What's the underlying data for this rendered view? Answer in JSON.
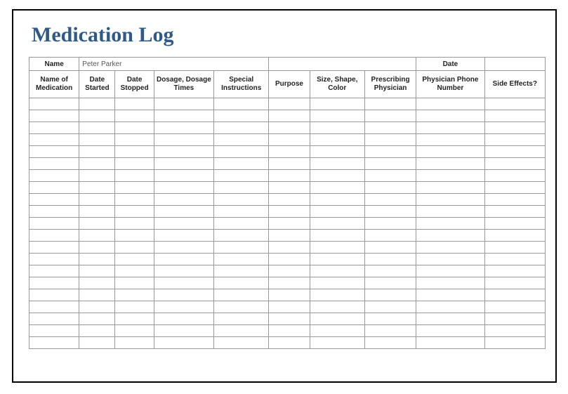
{
  "title": "Medication Log",
  "meta": {
    "name_label": "Name",
    "name_value": "Peter Parker",
    "date_label": "Date",
    "date_value": ""
  },
  "columns": [
    "Name of Medication",
    "Date Started",
    "Date Stopped",
    "Dosage, Dosage Times",
    "Special Instructions",
    "Purpose",
    "Size, Shape, Color",
    "Prescribing Physician",
    "Physician Phone Number",
    "Side Effects?"
  ],
  "rows": [
    [
      "",
      "",
      "",
      "",
      "",
      "",
      "",
      "",
      "",
      ""
    ],
    [
      "",
      "",
      "",
      "",
      "",
      "",
      "",
      "",
      "",
      ""
    ],
    [
      "",
      "",
      "",
      "",
      "",
      "",
      "",
      "",
      "",
      ""
    ],
    [
      "",
      "",
      "",
      "",
      "",
      "",
      "",
      "",
      "",
      ""
    ],
    [
      "",
      "",
      "",
      "",
      "",
      "",
      "",
      "",
      "",
      ""
    ],
    [
      "",
      "",
      "",
      "",
      "",
      "",
      "",
      "",
      "",
      ""
    ],
    [
      "",
      "",
      "",
      "",
      "",
      "",
      "",
      "",
      "",
      ""
    ],
    [
      "",
      "",
      "",
      "",
      "",
      "",
      "",
      "",
      "",
      ""
    ],
    [
      "",
      "",
      "",
      "",
      "",
      "",
      "",
      "",
      "",
      ""
    ],
    [
      "",
      "",
      "",
      "",
      "",
      "",
      "",
      "",
      "",
      ""
    ],
    [
      "",
      "",
      "",
      "",
      "",
      "",
      "",
      "",
      "",
      ""
    ],
    [
      "",
      "",
      "",
      "",
      "",
      "",
      "",
      "",
      "",
      ""
    ],
    [
      "",
      "",
      "",
      "",
      "",
      "",
      "",
      "",
      "",
      ""
    ],
    [
      "",
      "",
      "",
      "",
      "",
      "",
      "",
      "",
      "",
      ""
    ],
    [
      "",
      "",
      "",
      "",
      "",
      "",
      "",
      "",
      "",
      ""
    ],
    [
      "",
      "",
      "",
      "",
      "",
      "",
      "",
      "",
      "",
      ""
    ],
    [
      "",
      "",
      "",
      "",
      "",
      "",
      "",
      "",
      "",
      ""
    ],
    [
      "",
      "",
      "",
      "",
      "",
      "",
      "",
      "",
      "",
      ""
    ],
    [
      "",
      "",
      "",
      "",
      "",
      "",
      "",
      "",
      "",
      ""
    ],
    [
      "",
      "",
      "",
      "",
      "",
      "",
      "",
      "",
      "",
      ""
    ],
    [
      "",
      "",
      "",
      "",
      "",
      "",
      "",
      "",
      "",
      ""
    ]
  ]
}
